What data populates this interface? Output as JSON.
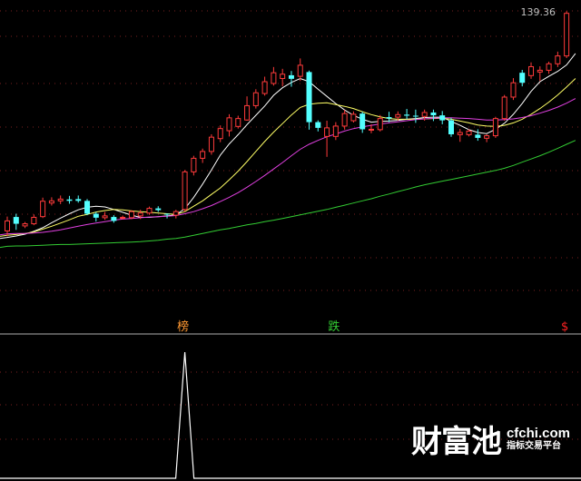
{
  "chart_data": {
    "type": "candlestick",
    "price_label": "139.36",
    "y_range_approx": [
      70,
      140
    ],
    "candles": [
      {
        "o": 78.0,
        "h": 82.0,
        "l": 76.5,
        "c": 80.8,
        "up": true
      },
      {
        "o": 80.0,
        "h": 82.8,
        "l": 78.3,
        "c": 81.9,
        "up": false
      },
      {
        "o": 79.4,
        "h": 80.5,
        "l": 78.8,
        "c": 80.0,
        "up": true
      },
      {
        "o": 80.0,
        "h": 82.6,
        "l": 79.6,
        "c": 81.8,
        "up": true
      },
      {
        "o": 82.0,
        "h": 87.3,
        "l": 81.6,
        "c": 86.3,
        "up": true
      },
      {
        "o": 85.8,
        "h": 87.4,
        "l": 85.1,
        "c": 86.4,
        "up": true
      },
      {
        "o": 86.4,
        "h": 87.9,
        "l": 85.5,
        "c": 86.9,
        "up": true
      },
      {
        "o": 86.4,
        "h": 87.8,
        "l": 85.6,
        "c": 86.8,
        "up": false
      },
      {
        "o": 86.9,
        "h": 87.9,
        "l": 85.9,
        "c": 86.4,
        "up": false
      },
      {
        "o": 86.4,
        "h": 86.9,
        "l": 82.4,
        "c": 82.8,
        "up": false
      },
      {
        "o": 82.8,
        "h": 83.3,
        "l": 80.6,
        "c": 81.7,
        "up": false
      },
      {
        "o": 81.7,
        "h": 83.3,
        "l": 81.1,
        "c": 82.2,
        "up": true
      },
      {
        "o": 81.9,
        "h": 82.4,
        "l": 80.3,
        "c": 80.8,
        "up": false
      },
      {
        "o": 81.7,
        "h": 82.3,
        "l": 81.2,
        "c": 81.8,
        "up": true
      },
      {
        "o": 81.7,
        "h": 83.8,
        "l": 81.3,
        "c": 83.4,
        "up": true
      },
      {
        "o": 82.2,
        "h": 83.9,
        "l": 81.3,
        "c": 83.0,
        "up": true
      },
      {
        "o": 83.0,
        "h": 84.8,
        "l": 82.5,
        "c": 84.3,
        "up": true
      },
      {
        "o": 84.3,
        "h": 84.9,
        "l": 83.3,
        "c": 83.8,
        "up": false
      },
      {
        "o": 82.8,
        "h": 82.9,
        "l": 81.5,
        "c": 82.6,
        "up": false
      },
      {
        "o": 83.4,
        "h": 83.9,
        "l": 81.5,
        "c": 82.4,
        "up": true
      },
      {
        "o": 84.0,
        "h": 95.0,
        "l": 83.4,
        "c": 94.5,
        "up": true
      },
      {
        "o": 94.5,
        "h": 99.0,
        "l": 93.5,
        "c": 98.3,
        "up": true
      },
      {
        "o": 98.3,
        "h": 101.0,
        "l": 97.0,
        "c": 100.2,
        "up": true
      },
      {
        "o": 100.2,
        "h": 105.0,
        "l": 99.3,
        "c": 104.2,
        "up": true
      },
      {
        "o": 103.8,
        "h": 107.5,
        "l": 102.8,
        "c": 106.6,
        "up": true
      },
      {
        "o": 106.0,
        "h": 110.6,
        "l": 104.4,
        "c": 109.6,
        "up": true
      },
      {
        "o": 107.2,
        "h": 110.2,
        "l": 106.6,
        "c": 109.4,
        "up": true
      },
      {
        "o": 109.0,
        "h": 115.6,
        "l": 108.8,
        "c": 113.0,
        "up": true
      },
      {
        "o": 113.0,
        "h": 117.6,
        "l": 112.2,
        "c": 116.6,
        "up": true
      },
      {
        "o": 116.4,
        "h": 121.1,
        "l": 115.8,
        "c": 119.7,
        "up": true
      },
      {
        "o": 119.2,
        "h": 123.8,
        "l": 118.6,
        "c": 122.2,
        "up": true
      },
      {
        "o": 121.8,
        "h": 123.3,
        "l": 118.4,
        "c": 120.6,
        "up": true
      },
      {
        "o": 121.5,
        "h": 122.7,
        "l": 118.3,
        "c": 120.5,
        "up": false
      },
      {
        "o": 121.2,
        "h": 126.2,
        "l": 119.9,
        "c": 124.3,
        "up": true
      },
      {
        "o": 122.4,
        "h": 122.8,
        "l": 106.3,
        "c": 108.4,
        "up": false
      },
      {
        "o": 108.4,
        "h": 108.9,
        "l": 105.8,
        "c": 106.8,
        "up": false
      },
      {
        "o": 104.4,
        "h": 108.8,
        "l": 98.7,
        "c": 106.8,
        "up": true
      },
      {
        "o": 104.4,
        "h": 108.4,
        "l": 103.4,
        "c": 107.3,
        "up": true
      },
      {
        "o": 107.3,
        "h": 111.8,
        "l": 106.3,
        "c": 110.8,
        "up": true
      },
      {
        "o": 108.8,
        "h": 111.4,
        "l": 108.3,
        "c": 110.6,
        "up": true
      },
      {
        "o": 110.8,
        "h": 111.3,
        "l": 105.4,
        "c": 106.4,
        "up": false
      },
      {
        "o": 106.4,
        "h": 107.8,
        "l": 105.3,
        "c": 106.3,
        "up": true
      },
      {
        "o": 106.3,
        "h": 110.4,
        "l": 105.8,
        "c": 109.4,
        "up": true
      },
      {
        "o": 109.4,
        "h": 111.3,
        "l": 108.4,
        "c": 109.8,
        "up": false
      },
      {
        "o": 109.8,
        "h": 111.4,
        "l": 108.8,
        "c": 110.5,
        "up": true
      },
      {
        "o": 110.5,
        "h": 112.1,
        "l": 109.2,
        "c": 110.2,
        "up": false
      },
      {
        "o": 110.2,
        "h": 111.9,
        "l": 108.2,
        "c": 110.0,
        "up": false
      },
      {
        "o": 110.0,
        "h": 111.9,
        "l": 108.8,
        "c": 111.1,
        "up": true
      },
      {
        "o": 111.1,
        "h": 111.9,
        "l": 108.7,
        "c": 110.3,
        "up": false
      },
      {
        "o": 110.3,
        "h": 111.5,
        "l": 107.8,
        "c": 108.9,
        "up": false
      },
      {
        "o": 108.9,
        "h": 109.6,
        "l": 104.3,
        "c": 105.0,
        "up": false
      },
      {
        "o": 105.5,
        "h": 106.5,
        "l": 102.9,
        "c": 104.9,
        "up": true
      },
      {
        "o": 104.9,
        "h": 106.4,
        "l": 104.4,
        "c": 105.9,
        "up": true
      },
      {
        "o": 104.9,
        "h": 106.4,
        "l": 103.2,
        "c": 104.0,
        "up": false
      },
      {
        "o": 103.9,
        "h": 105.0,
        "l": 102.8,
        "c": 104.6,
        "up": true
      },
      {
        "o": 104.6,
        "h": 109.9,
        "l": 104.0,
        "c": 109.4,
        "up": true
      },
      {
        "o": 109.4,
        "h": 116.0,
        "l": 108.8,
        "c": 115.4,
        "up": true
      },
      {
        "o": 115.4,
        "h": 120.7,
        "l": 114.6,
        "c": 119.4,
        "up": true
      },
      {
        "o": 119.4,
        "h": 123.0,
        "l": 118.4,
        "c": 122.2,
        "up": false
      },
      {
        "o": 121.4,
        "h": 125.1,
        "l": 120.5,
        "c": 123.9,
        "up": true
      },
      {
        "o": 122.4,
        "h": 124.0,
        "l": 119.9,
        "c": 122.9,
        "up": true
      },
      {
        "o": 122.9,
        "h": 125.3,
        "l": 121.9,
        "c": 124.7,
        "up": true
      },
      {
        "o": 124.7,
        "h": 128.1,
        "l": 123.8,
        "c": 126.9,
        "up": true
      },
      {
        "o": 126.9,
        "h": 139.4,
        "l": 126.3,
        "c": 138.8,
        "up": true
      }
    ],
    "ma_series": [
      {
        "color": "#ffffff",
        "values": [
          76.2,
          76.6,
          77.1,
          77.9,
          78.9,
          80.3,
          81.6,
          82.8,
          83.9,
          84.6,
          84.9,
          84.7,
          84.0,
          83.2,
          82.4,
          81.8,
          81.8,
          82.0,
          82.2,
          82.5,
          84.2,
          87.4,
          91.1,
          95.0,
          99.2,
          102.3,
          104.9,
          107.7,
          110.3,
          112.9,
          115.9,
          118.0,
          119.5,
          120.6,
          119.7,
          117.6,
          115.6,
          113.6,
          111.8,
          110.3,
          109.2,
          108.4,
          108.6,
          108.7,
          108.9,
          109.2,
          109.4,
          109.7,
          109.8,
          109.8,
          108.6,
          107.5,
          106.3,
          105.5,
          105.2,
          106.4,
          108.1,
          110.6,
          113.6,
          117.0,
          119.7,
          121.2,
          122.6,
          124.4,
          127.6
        ]
      },
      {
        "color": "#ffff66",
        "values": [
          76.8,
          77.0,
          77.3,
          77.7,
          78.5,
          79.3,
          80.2,
          81.1,
          82.1,
          82.6,
          83.3,
          83.7,
          84.0,
          83.9,
          83.6,
          83.4,
          83.2,
          83.0,
          82.8,
          82.6,
          83.4,
          84.9,
          86.4,
          88.2,
          90.0,
          92.3,
          94.7,
          97.4,
          100.2,
          103.0,
          105.6,
          108.0,
          110.4,
          112.5,
          113.4,
          113.7,
          113.8,
          113.3,
          112.8,
          112.2,
          111.3,
          110.5,
          109.9,
          109.4,
          109.2,
          109.2,
          109.2,
          109.3,
          109.4,
          109.5,
          109.2,
          108.7,
          108.2,
          107.6,
          107.3,
          107.2,
          107.5,
          108.2,
          109.2,
          110.6,
          112.2,
          114.0,
          116.0,
          118.2,
          120.6
        ]
      },
      {
        "color": "#e040e0",
        "values": [
          77.2,
          77.3,
          77.3,
          77.4,
          77.6,
          77.9,
          78.3,
          78.8,
          79.3,
          79.8,
          80.2,
          80.6,
          81.0,
          81.3,
          81.5,
          81.7,
          81.9,
          82.0,
          82.1,
          82.3,
          82.8,
          83.4,
          84.2,
          85.1,
          86.2,
          87.4,
          88.7,
          90.2,
          91.8,
          93.5,
          95.3,
          97.1,
          99.0,
          100.8,
          102.2,
          103.3,
          104.3,
          105.1,
          105.9,
          106.6,
          107.1,
          107.5,
          107.9,
          108.2,
          108.5,
          108.8,
          109.1,
          109.3,
          109.5,
          109.6,
          109.6,
          109.5,
          109.4,
          109.2,
          109.0,
          109.0,
          109.1,
          109.3,
          109.7,
          110.2,
          110.9,
          111.7,
          112.6,
          113.7,
          115.0
        ]
      },
      {
        "color": "#33cc33",
        "values": [
          73.7,
          73.8,
          73.8,
          73.9,
          74.0,
          74.1,
          74.2,
          74.2,
          74.3,
          74.4,
          74.5,
          74.6,
          74.7,
          74.8,
          74.9,
          75.0,
          75.2,
          75.4,
          75.7,
          75.9,
          76.3,
          76.8,
          77.3,
          77.8,
          78.3,
          78.7,
          79.2,
          79.7,
          80.1,
          80.6,
          81.0,
          81.5,
          82.0,
          82.5,
          83.0,
          83.5,
          84.0,
          84.6,
          85.2,
          85.8,
          86.4,
          87.0,
          87.7,
          88.3,
          89.0,
          89.6,
          90.3,
          90.9,
          91.4,
          91.9,
          92.4,
          92.9,
          93.4,
          93.9,
          94.4,
          94.9,
          95.5,
          96.3,
          97.2,
          98.1,
          99.0,
          100.0,
          101.1,
          102.2,
          103.3
        ]
      }
    ],
    "signals": [
      {
        "index": 20,
        "label": "榜",
        "color": "#ff9933"
      },
      {
        "index": 37,
        "label": "跌",
        "color": "#33cc33"
      },
      {
        "index": 63,
        "label": "$",
        "color": "#ff2222"
      }
    ],
    "indicator": {
      "spike_index": 20,
      "values": [
        0,
        0,
        0,
        0,
        0,
        0,
        0,
        0,
        0,
        0,
        0,
        0,
        0,
        0,
        0,
        0,
        0,
        0,
        0,
        0,
        1,
        0,
        0,
        0,
        0,
        0,
        0,
        0,
        0,
        0,
        0,
        0,
        0,
        0,
        0,
        0,
        0,
        0,
        0,
        0,
        0,
        0,
        0,
        0,
        0,
        0,
        0,
        0,
        0,
        0,
        0,
        0,
        0,
        0,
        0,
        0,
        0,
        0,
        0,
        0,
        0,
        0,
        0,
        0,
        0
      ]
    }
  },
  "watermark": {
    "cn": "财富池",
    "url": "cfchi.com",
    "sub": "指标交易平台"
  }
}
